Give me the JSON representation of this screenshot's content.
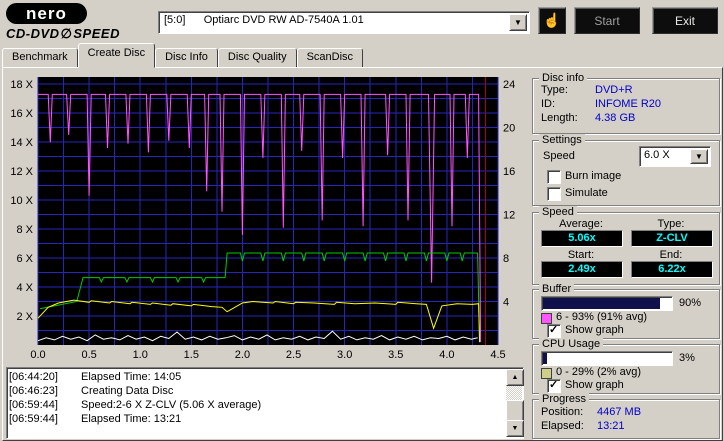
{
  "header": {
    "logo_primary": "nero",
    "logo_secondary": "CD-DVD",
    "logo_icon": "∅",
    "logo_speed": "SPEED",
    "drive_selector": "[5:0]      Optiarc DVD RW AD-7540A 1.01",
    "select_icon": "☝",
    "start_button": "Start",
    "exit_button": "Exit"
  },
  "tabs": [
    {
      "label": "Benchmark"
    },
    {
      "label": "Create Disc"
    },
    {
      "label": "Disc Info"
    },
    {
      "label": "Disc Quality"
    },
    {
      "label": "ScanDisc"
    }
  ],
  "disc_info": {
    "title": "Disc info",
    "type_label": "Type:",
    "type_value": "DVD+R",
    "id_label": "ID:",
    "id_value": "INFOME R20",
    "length_label": "Length:",
    "length_value": "4.38 GB"
  },
  "settings": {
    "title": "Settings",
    "speed_label": "Speed",
    "speed_value": "6.0 X",
    "burn_image_label": "Burn image",
    "burn_image_checked": false,
    "simulate_label": "Simulate",
    "simulate_checked": false
  },
  "speed": {
    "title": "Speed",
    "average_label": "Average:",
    "average_value": "5.06x",
    "type_label": "Type:",
    "type_value": "Z-CLV",
    "start_label": "Start:",
    "start_value": "2.49x",
    "end_label": "End:",
    "end_value": "6.22x"
  },
  "buffer": {
    "title": "Buffer",
    "percent_label": "90%",
    "percent_value": 90,
    "range_text": "6 - 93% (91% avg)",
    "show_graph_label": "Show graph",
    "show_graph_checked": true,
    "swatch_color": "#ff55ff"
  },
  "cpu": {
    "title": "CPU Usage",
    "percent_label": "3%",
    "percent_value": 3,
    "range_text": "0 - 29% (2% avg)",
    "show_graph_label": "Show graph",
    "show_graph_checked": true,
    "swatch_color": "#cfcf8a"
  },
  "progress": {
    "title": "Progress",
    "position_label": "Position:",
    "position_value": "4467 MB",
    "elapsed_label": "Elapsed:",
    "elapsed_value": "13:21"
  },
  "log": {
    "lines": [
      {
        "time": "[06:44:20]",
        "text": "Elapsed Time: 14:05"
      },
      {
        "time": "[06:46:23]",
        "text": "Creating Data Disc"
      },
      {
        "time": "[06:59:44]",
        "text": "Speed:2-6 X Z-CLV (5.06 X average)"
      },
      {
        "time": "[06:59:44]",
        "text": "Elapsed Time: 13:21"
      }
    ]
  },
  "chart_data": {
    "type": "line",
    "title": "",
    "bg_color": "#000000",
    "grid": {
      "x_step": 0.25,
      "y_step": 1,
      "color": "#2626bb"
    },
    "x_axis": {
      "label": "",
      "min": 0,
      "max": 4.5,
      "ticks": [
        [
          0,
          "0.0"
        ],
        [
          0.5,
          "0.5"
        ],
        [
          1,
          "1.0"
        ],
        [
          1.5,
          "1.5"
        ],
        [
          2,
          "2.0"
        ],
        [
          2.5,
          "2.5"
        ],
        [
          3,
          "3.0"
        ],
        [
          3.5,
          "3.5"
        ],
        [
          4,
          "4.0"
        ],
        [
          4.5,
          "4.5"
        ]
      ]
    },
    "left_axis": {
      "label": "",
      "min": 0,
      "max": 18.5,
      "ticks": [
        [
          18,
          "18 X"
        ],
        [
          16,
          "16 X"
        ],
        [
          14,
          "14 X"
        ],
        [
          12,
          "12 X"
        ],
        [
          10,
          "10 X"
        ],
        [
          8,
          "8 X"
        ],
        [
          6,
          "6 X"
        ],
        [
          4,
          "4 X"
        ],
        [
          2,
          "2 X"
        ]
      ]
    },
    "right_axis": {
      "align_ratio": 0.75,
      "ticks": [
        [
          24,
          "24"
        ],
        [
          20,
          "20"
        ],
        [
          16,
          "16"
        ],
        [
          12,
          "12"
        ],
        [
          8,
          "8"
        ],
        [
          4,
          "4"
        ]
      ]
    },
    "end_marker": {
      "x": 4.38,
      "color": "#b40000"
    },
    "series": [
      {
        "name": "buffer-level",
        "color": "#ff55ff",
        "points": [
          [
            0,
            17.3
          ],
          [
            0.1,
            17.3
          ],
          [
            0.12,
            14
          ],
          [
            0.14,
            17.3
          ],
          [
            0.28,
            17.3
          ],
          [
            0.3,
            14.5
          ],
          [
            0.32,
            17.3
          ],
          [
            0.48,
            17.3
          ],
          [
            0.5,
            10.3
          ],
          [
            0.52,
            17.3
          ],
          [
            0.66,
            17.3
          ],
          [
            0.68,
            13.6
          ],
          [
            0.7,
            17.3
          ],
          [
            0.86,
            17.3
          ],
          [
            0.88,
            13.9
          ],
          [
            0.9,
            17.3
          ],
          [
            1.06,
            17.3
          ],
          [
            1.08,
            13.3
          ],
          [
            1.1,
            17.3
          ],
          [
            1.26,
            17.3
          ],
          [
            1.28,
            14.1
          ],
          [
            1.3,
            17.3
          ],
          [
            1.46,
            17.3
          ],
          [
            1.48,
            13.6
          ],
          [
            1.5,
            17.3
          ],
          [
            1.63,
            17.3
          ],
          [
            1.65,
            10.6
          ],
          [
            1.67,
            17.3
          ],
          [
            1.78,
            17.3
          ],
          [
            1.8,
            9.2
          ],
          [
            1.82,
            17.3
          ],
          [
            1.98,
            17.3
          ],
          [
            2,
            7.6
          ],
          [
            2.02,
            17.3
          ],
          [
            2.18,
            17.3
          ],
          [
            2.2,
            12.9
          ],
          [
            2.22,
            17.3
          ],
          [
            2.38,
            17.3
          ],
          [
            2.4,
            8.1
          ],
          [
            2.42,
            17.3
          ],
          [
            2.56,
            17.3
          ],
          [
            2.58,
            13.4
          ],
          [
            2.6,
            17.3
          ],
          [
            2.76,
            17.3
          ],
          [
            2.78,
            8.6
          ],
          [
            2.8,
            17.3
          ],
          [
            2.96,
            17.3
          ],
          [
            2.98,
            12.9
          ],
          [
            3,
            17.3
          ],
          [
            3.16,
            17.3
          ],
          [
            3.18,
            8.2
          ],
          [
            3.2,
            17.3
          ],
          [
            3.4,
            17.3
          ],
          [
            3.42,
            13.1
          ],
          [
            3.44,
            17.3
          ],
          [
            3.6,
            17.3
          ],
          [
            3.62,
            8.6
          ],
          [
            3.64,
            17.3
          ],
          [
            3.82,
            17.3
          ],
          [
            3.85,
            4.3
          ],
          [
            3.88,
            17.3
          ],
          [
            4.03,
            17.3
          ],
          [
            4.05,
            8.2
          ],
          [
            4.07,
            17.3
          ],
          [
            4.18,
            17.3
          ],
          [
            4.2,
            12.9
          ],
          [
            4.22,
            17.3
          ],
          [
            4.31,
            17.3
          ],
          [
            4.33,
            0.2
          ]
        ]
      },
      {
        "name": "write-speed-zones",
        "color": "#00cc00",
        "points": [
          [
            0.02,
            2.5
          ],
          [
            0.38,
            3
          ],
          [
            0.44,
            4.65
          ],
          [
            0.6,
            4.65
          ],
          [
            0.62,
            4.35
          ],
          [
            0.64,
            4.65
          ],
          [
            0.85,
            4.65
          ],
          [
            0.87,
            4.35
          ],
          [
            0.89,
            4.65
          ],
          [
            1.1,
            4.65
          ],
          [
            1.12,
            4.35
          ],
          [
            1.14,
            4.65
          ],
          [
            1.35,
            4.65
          ],
          [
            1.37,
            4.35
          ],
          [
            1.39,
            4.65
          ],
          [
            1.6,
            4.65
          ],
          [
            1.62,
            4.35
          ],
          [
            1.64,
            4.65
          ],
          [
            1.83,
            4.65
          ],
          [
            1.85,
            6.35
          ],
          [
            1.98,
            6.35
          ],
          [
            2,
            5.8
          ],
          [
            2.02,
            6.35
          ],
          [
            2.18,
            6.35
          ],
          [
            2.2,
            5.8
          ],
          [
            2.22,
            6.35
          ],
          [
            2.38,
            6.35
          ],
          [
            2.4,
            5.8
          ],
          [
            2.42,
            6.35
          ],
          [
            2.58,
            6.35
          ],
          [
            2.6,
            5.8
          ],
          [
            2.62,
            6.35
          ],
          [
            2.78,
            6.35
          ],
          [
            2.8,
            5.8
          ],
          [
            2.82,
            6.35
          ],
          [
            2.98,
            6.35
          ],
          [
            3,
            5.8
          ],
          [
            3.02,
            6.35
          ],
          [
            3.18,
            6.35
          ],
          [
            3.2,
            5.8
          ],
          [
            3.22,
            6.35
          ],
          [
            3.38,
            6.35
          ],
          [
            3.4,
            5.8
          ],
          [
            3.42,
            6.35
          ],
          [
            3.58,
            6.35
          ],
          [
            3.6,
            5.8
          ],
          [
            3.62,
            6.35
          ],
          [
            3.78,
            6.35
          ],
          [
            3.8,
            5.8
          ],
          [
            3.82,
            6.35
          ],
          [
            3.98,
            6.35
          ],
          [
            4,
            5.8
          ],
          [
            4.02,
            6.35
          ],
          [
            4.13,
            6.35
          ],
          [
            4.15,
            5.8
          ],
          [
            4.17,
            6.35
          ],
          [
            4.3,
            6.35
          ],
          [
            4.32,
            0.2
          ]
        ]
      },
      {
        "name": "write-speed-measured",
        "color": "#ffff00",
        "points": [
          [
            0,
            1.85
          ],
          [
            0.1,
            2.6
          ],
          [
            0.2,
            2.9
          ],
          [
            0.35,
            3.1
          ],
          [
            0.5,
            2.95
          ],
          [
            0.52,
            3.05
          ],
          [
            0.7,
            2.9
          ],
          [
            0.72,
            3
          ],
          [
            0.9,
            2.85
          ],
          [
            0.92,
            2.95
          ],
          [
            1.1,
            2.8
          ],
          [
            1.12,
            2.9
          ],
          [
            1.3,
            2.75
          ],
          [
            1.32,
            2.85
          ],
          [
            1.5,
            2.7
          ],
          [
            1.52,
            2.8
          ],
          [
            1.7,
            2.65
          ],
          [
            1.8,
            2.6
          ],
          [
            1.85,
            2.3
          ],
          [
            1.9,
            2.5
          ],
          [
            2,
            2.9
          ],
          [
            2.1,
            3
          ],
          [
            2.3,
            2.9
          ],
          [
            2.32,
            3
          ],
          [
            2.5,
            2.85
          ],
          [
            2.52,
            2.95
          ],
          [
            2.7,
            2.9
          ],
          [
            2.9,
            2.8
          ],
          [
            2.92,
            2.95
          ],
          [
            3.1,
            2.85
          ],
          [
            3.3,
            2.9
          ],
          [
            3.5,
            2.8
          ],
          [
            3.52,
            2.95
          ],
          [
            3.7,
            2.85
          ],
          [
            3.8,
            2.8
          ],
          [
            3.87,
            1.15
          ],
          [
            3.95,
            2.7
          ],
          [
            4.1,
            2.85
          ],
          [
            4.25,
            2.8
          ],
          [
            4.31,
            2.85
          ],
          [
            4.32,
            0.2
          ]
        ]
      },
      {
        "name": "cpu-usage",
        "color": "#ffffff",
        "points": [
          [
            0,
            0.3
          ],
          [
            0.08,
            0.5
          ],
          [
            0.16,
            0.35
          ],
          [
            0.24,
            0.6
          ],
          [
            0.32,
            0.4
          ],
          [
            0.4,
            0.55
          ],
          [
            0.48,
            0.3
          ],
          [
            0.56,
            0.7
          ],
          [
            0.64,
            0.4
          ],
          [
            0.72,
            0.5
          ],
          [
            0.8,
            0.35
          ],
          [
            0.88,
            0.65
          ],
          [
            0.96,
            0.4
          ],
          [
            1.04,
            0.55
          ],
          [
            1.12,
            0.3
          ],
          [
            1.2,
            0.6
          ],
          [
            1.28,
            0.45
          ],
          [
            1.36,
            0.9
          ],
          [
            1.44,
            0.4
          ],
          [
            1.52,
            0.55
          ],
          [
            1.6,
            0.35
          ],
          [
            1.68,
            0.6
          ],
          [
            1.76,
            0.4
          ],
          [
            1.84,
            0.5
          ],
          [
            1.92,
            0.65
          ],
          [
            2,
            0.35
          ],
          [
            2.08,
            0.55
          ],
          [
            2.16,
            0.4
          ],
          [
            2.24,
            0.7
          ],
          [
            2.32,
            0.35
          ],
          [
            2.4,
            0.5
          ],
          [
            2.48,
            0.4
          ],
          [
            2.56,
            0.6
          ],
          [
            2.64,
            0.35
          ],
          [
            2.72,
            0.55
          ],
          [
            2.8,
            0.45
          ],
          [
            2.88,
            0.95
          ],
          [
            2.96,
            0.4
          ],
          [
            3.04,
            0.6
          ],
          [
            3.12,
            0.35
          ],
          [
            3.2,
            0.5
          ],
          [
            3.28,
            0.4
          ],
          [
            3.36,
            0.65
          ],
          [
            3.44,
            0.35
          ],
          [
            3.52,
            0.55
          ],
          [
            3.6,
            0.4
          ],
          [
            3.68,
            0.6
          ],
          [
            3.76,
            0.35
          ],
          [
            3.84,
            0.5
          ],
          [
            3.92,
            0.45
          ],
          [
            4,
            0.6
          ],
          [
            4.08,
            0.35
          ],
          [
            4.16,
            0.55
          ],
          [
            4.24,
            0.4
          ],
          [
            4.3,
            0.5
          ]
        ]
      }
    ]
  }
}
